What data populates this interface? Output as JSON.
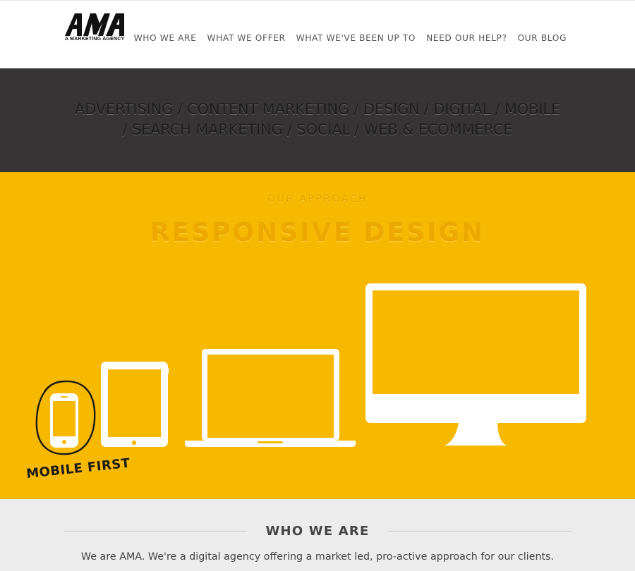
{
  "header": {
    "logo_text": "AMA",
    "logo_subtitle": "A MARKETING AGENCY",
    "nav": [
      {
        "label": "WHO WE ARE"
      },
      {
        "label": "WHAT WE OFFER"
      },
      {
        "label": "WHAT WE'VE BEEN UP TO"
      },
      {
        "label": "NEED OUR HELP?"
      },
      {
        "label": "OUR BLOG"
      }
    ]
  },
  "services": {
    "line1": "ADVERTISING / CONTENT MARKETING / DESIGN / DIGITAL / MOBILE",
    "line2": "/ SEARCH MARKETING / SOCIAL / WEB & ECOMMERCE"
  },
  "approach": {
    "eyebrow": "OUR APPROACH",
    "title": "RESPONSIVE DESIGN",
    "mobile_first_label": "MOBILE FIRST",
    "devices": [
      {
        "icon": "smartphone-icon"
      },
      {
        "icon": "tablet-icon"
      },
      {
        "icon": "laptop-icon"
      },
      {
        "icon": "desktop-monitor-icon"
      }
    ]
  },
  "who": {
    "heading": "WHO WE ARE",
    "body": "We are AMA. We're a digital agency offering a market led, pro-active approach for our clients."
  },
  "colors": {
    "header_bg": "#ffffff",
    "services_bg": "#363435",
    "approach_bg": "#f7b800",
    "who_bg": "#ececec",
    "nav_text": "#555555"
  }
}
